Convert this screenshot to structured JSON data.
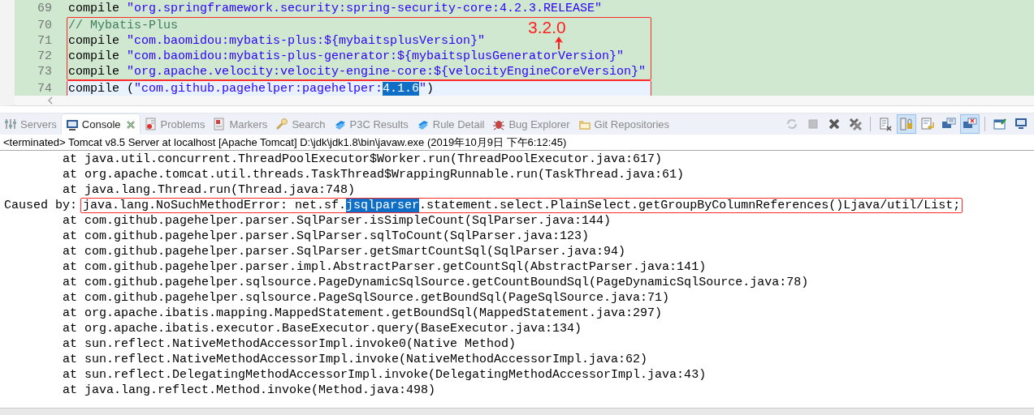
{
  "editor": {
    "blocks": [
      {
        "boxed": false,
        "lines": [
          {
            "number": "69",
            "current": false,
            "segments": [
              {
                "kind": "plain",
                "text": "compile "
              },
              {
                "kind": "string",
                "text": "\"org.springframework.security:spring-security-core:4.2.3.RELEASE\""
              }
            ]
          }
        ]
      },
      {
        "boxed": true,
        "note": "3.2.0",
        "lines": [
          {
            "number": "70",
            "current": false,
            "segments": [
              {
                "kind": "comment",
                "text": "// Mybatis-Plus"
              }
            ]
          },
          {
            "number": "71",
            "current": false,
            "segments": [
              {
                "kind": "plain",
                "text": "compile "
              },
              {
                "kind": "string",
                "text": "\"com.baomidou:mybatis-plus:${mybaitsplusVersion}\""
              }
            ]
          },
          {
            "number": "72",
            "current": false,
            "segments": [
              {
                "kind": "plain",
                "text": "compile "
              },
              {
                "kind": "string",
                "text": "\"com.baomidou:mybatis-plus-generator:${mybaitsplusGeneratorVersion}\""
              }
            ]
          },
          {
            "number": "73",
            "current": false,
            "segments": [
              {
                "kind": "plain",
                "text": "compile "
              },
              {
                "kind": "string",
                "text": "\"org.apache.velocity:velocity-engine-core:${velocityEngineCoreVersion}\""
              }
            ]
          }
        ]
      },
      {
        "boxed": true,
        "lines": [
          {
            "number": "74",
            "current": true,
            "segments": [
              {
                "kind": "plain",
                "text": "compile ("
              },
              {
                "kind": "string",
                "text": "\"com.github.pagehelper:pagehelper:"
              },
              {
                "kind": "selection",
                "text": "4.1.6"
              },
              {
                "kind": "string",
                "text": "\""
              },
              {
                "kind": "plain",
                "text": ")"
              }
            ]
          }
        ]
      }
    ]
  },
  "tabs": [
    {
      "kind": "servers",
      "label": "Servers",
      "selected": false,
      "closable": false
    },
    {
      "kind": "console",
      "label": "Console",
      "selected": true,
      "closable": true
    },
    {
      "kind": "problems",
      "label": "Problems",
      "selected": false,
      "closable": false
    },
    {
      "kind": "markers",
      "label": "Markers",
      "selected": false,
      "closable": false
    },
    {
      "kind": "search",
      "label": "Search",
      "selected": false,
      "closable": false
    },
    {
      "kind": "p3c",
      "label": "P3C Results",
      "selected": false,
      "closable": false
    },
    {
      "kind": "p3c",
      "label": "Rule Detail",
      "selected": false,
      "closable": false
    },
    {
      "kind": "bug",
      "label": "Bug Explorer",
      "selected": false,
      "closable": false
    },
    {
      "kind": "git",
      "label": "Git Repositories",
      "selected": false,
      "closable": false
    }
  ],
  "toolbar": [
    {
      "kind": "refresh",
      "on": false,
      "disabled": true
    },
    {
      "kind": "terminate",
      "on": false,
      "disabled": true
    },
    {
      "kind": "remove",
      "on": false,
      "disabled": false
    },
    {
      "kind": "remove-all",
      "on": false,
      "disabled": false
    },
    {
      "kind": "sep"
    },
    {
      "kind": "clear",
      "on": false,
      "disabled": false
    },
    {
      "kind": "scroll-lock",
      "on": true,
      "disabled": false
    },
    {
      "kind": "word-wrap",
      "on": false,
      "disabled": false
    },
    {
      "kind": "show-out",
      "on": false,
      "disabled": false
    },
    {
      "kind": "show-err",
      "on": true,
      "disabled": false
    },
    {
      "kind": "sep"
    },
    {
      "kind": "pin",
      "on": false,
      "disabled": false
    },
    {
      "kind": "display",
      "on": false,
      "disabled": false
    }
  ],
  "console": {
    "status": "<terminated> Tomcat v8.5 Server at localhost [Apache Tomcat] D:\\jdk\\jdk1.8\\bin\\javaw.exe (2019年10月9日 下午6:12:45)",
    "lines": [
      {
        "kind": "frame",
        "text": "at java.util.concurrent.ThreadPoolExecutor$Worker.run(ThreadPoolExecutor.java:617)"
      },
      {
        "kind": "frame",
        "text": "at org.apache.tomcat.util.threads.TaskThread$WrappingRunnable.run(TaskThread.java:61)"
      },
      {
        "kind": "frame",
        "text": "at java.lang.Thread.run(Thread.java:748)"
      },
      {
        "kind": "cause",
        "label": "Caused by:",
        "boxed": true,
        "segments": [
          {
            "kind": "plain",
            "text": "java.lang.NoSuchMethodError: net.sf."
          },
          {
            "kind": "selection",
            "text": "jsqlparser"
          },
          {
            "kind": "plain",
            "text": ".statement.select.PlainSelect.getGroupByColumnReferences()Ljava/util/List;"
          }
        ]
      },
      {
        "kind": "frame",
        "text": "at com.github.pagehelper.parser.SqlParser.isSimpleCount(SqlParser.java:144)"
      },
      {
        "kind": "frame",
        "text": "at com.github.pagehelper.parser.SqlParser.sqlToCount(SqlParser.java:123)"
      },
      {
        "kind": "frame",
        "text": "at com.github.pagehelper.parser.SqlParser.getSmartCountSql(SqlParser.java:94)"
      },
      {
        "kind": "frame",
        "text": "at com.github.pagehelper.parser.impl.AbstractParser.getCountSql(AbstractParser.java:141)"
      },
      {
        "kind": "frame",
        "text": "at com.github.pagehelper.sqlsource.PageDynamicSqlSource.getCountBoundSql(PageDynamicSqlSource.java:78)"
      },
      {
        "kind": "frame",
        "text": "at com.github.pagehelper.sqlsource.PageSqlSource.getBoundSql(PageSqlSource.java:71)"
      },
      {
        "kind": "frame",
        "text": "at org.apache.ibatis.mapping.MappedStatement.getBoundSql(MappedStatement.java:297)"
      },
      {
        "kind": "frame",
        "text": "at org.apache.ibatis.executor.BaseExecutor.query(BaseExecutor.java:134)"
      },
      {
        "kind": "frame",
        "text": "at sun.reflect.NativeMethodAccessorImpl.invoke0(Native Method)"
      },
      {
        "kind": "frame",
        "text": "at sun.reflect.NativeMethodAccessorImpl.invoke(NativeMethodAccessorImpl.java:62)"
      },
      {
        "kind": "frame",
        "text": "at sun.reflect.DelegatingMethodAccessorImpl.invoke(DelegatingMethodAccessorImpl.java:43)"
      },
      {
        "kind": "frame",
        "text": "at java.lang.reflect.Method.invoke(Method.java:498)"
      }
    ]
  }
}
